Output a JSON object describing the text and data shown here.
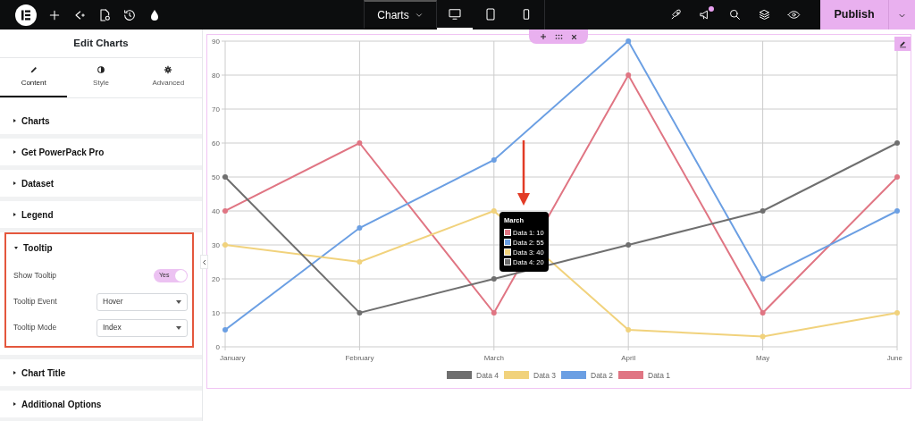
{
  "topbar": {
    "page_menu": "Charts",
    "devices": [
      {
        "kind": "desktop",
        "selected": true
      },
      {
        "kind": "tablet",
        "selected": false
      },
      {
        "kind": "mobile",
        "selected": false
      }
    ],
    "publish": "Publish"
  },
  "panel": {
    "title": "Edit Charts",
    "tabs": [
      {
        "label": "Content",
        "kind": "pencil",
        "selected": true
      },
      {
        "label": "Style",
        "kind": "contrast",
        "selected": false
      },
      {
        "label": "Advanced",
        "kind": "gear",
        "selected": false
      }
    ],
    "sections": [
      {
        "label": "Charts",
        "expanded": false
      },
      {
        "label": "Get PowerPack Pro",
        "expanded": false
      },
      {
        "label": "Dataset",
        "expanded": false
      },
      {
        "label": "Legend",
        "expanded": false
      },
      {
        "label": "Tooltip",
        "expanded": true,
        "controls": [
          {
            "kind": "toggle",
            "label": "Show Tooltip",
            "value": "Yes",
            "on": true
          },
          {
            "kind": "select",
            "label": "Tooltip Event",
            "value": "Hover"
          },
          {
            "kind": "select",
            "label": "Tooltip Mode",
            "value": "Index"
          }
        ]
      },
      {
        "label": "Chart Title",
        "expanded": false
      },
      {
        "label": "Additional Options",
        "expanded": false
      }
    ]
  },
  "chart": {
    "chart_data": {
      "type": "line",
      "grid": true,
      "legend": true,
      "categories": [
        "January",
        "February",
        "March",
        "April",
        "May",
        "June"
      ],
      "ylim": [
        0,
        90
      ],
      "yticks": [
        0,
        10,
        20,
        30,
        40,
        50,
        60,
        70,
        80,
        90
      ],
      "series": [
        {
          "name": "Data 1",
          "color": "#e07583",
          "marker": "circle",
          "values": [
            40,
            60,
            10,
            80,
            10,
            50
          ]
        },
        {
          "name": "Data 2",
          "color": "#6b9fe3",
          "marker": "circle",
          "values": [
            5,
            35,
            55,
            90,
            20,
            40
          ]
        },
        {
          "name": "Data 3",
          "color": "#f1d27c",
          "marker": "circle",
          "values": [
            30,
            25,
            40,
            5,
            3,
            10
          ]
        },
        {
          "name": "Data 4",
          "color": "#6f6f6f",
          "marker": "circle",
          "values": [
            50,
            10,
            20,
            30,
            40,
            60
          ]
        }
      ]
    },
    "tooltip": {
      "title": "March",
      "items": [
        {
          "label": "Data 1: 10",
          "color": "#e07583"
        },
        {
          "label": "Data 2: 55",
          "color": "#6b9fe3"
        },
        {
          "label": "Data 3: 40",
          "color": "#f1d27c"
        },
        {
          "label": "Data 4: 20",
          "color": "#6f6f6f"
        }
      ]
    }
  }
}
